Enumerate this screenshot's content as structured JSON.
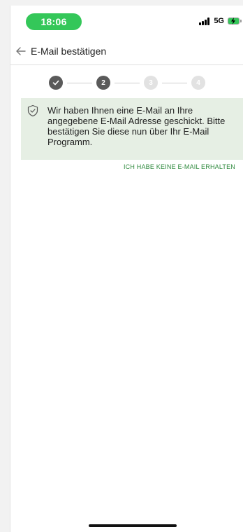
{
  "status_bar": {
    "time": "18:06",
    "network": "5G",
    "accent_color": "#34c759"
  },
  "app_bar": {
    "back_icon": "arrow-left-icon",
    "title": "E-Mail bestätigen"
  },
  "stepper": {
    "steps": [
      {
        "label": "",
        "state": "done",
        "icon": "checkmark-icon"
      },
      {
        "label": "2",
        "state": "active"
      },
      {
        "label": "3",
        "state": "pending"
      },
      {
        "label": "4",
        "state": "pending"
      }
    ]
  },
  "info": {
    "icon": "shield-check-icon",
    "message": "Wir haben Ihnen eine E-Mail an Ihre angegebene E-Mail Adresse geschickt. Bitte bestätigen Sie diese nun über Ihr E-Mail Programm.",
    "background": "#e6efe4"
  },
  "actions": {
    "resend_label": "ICH HABE KEINE E-MAIL ERHALTEN",
    "link_color": "#2f8a3e"
  }
}
